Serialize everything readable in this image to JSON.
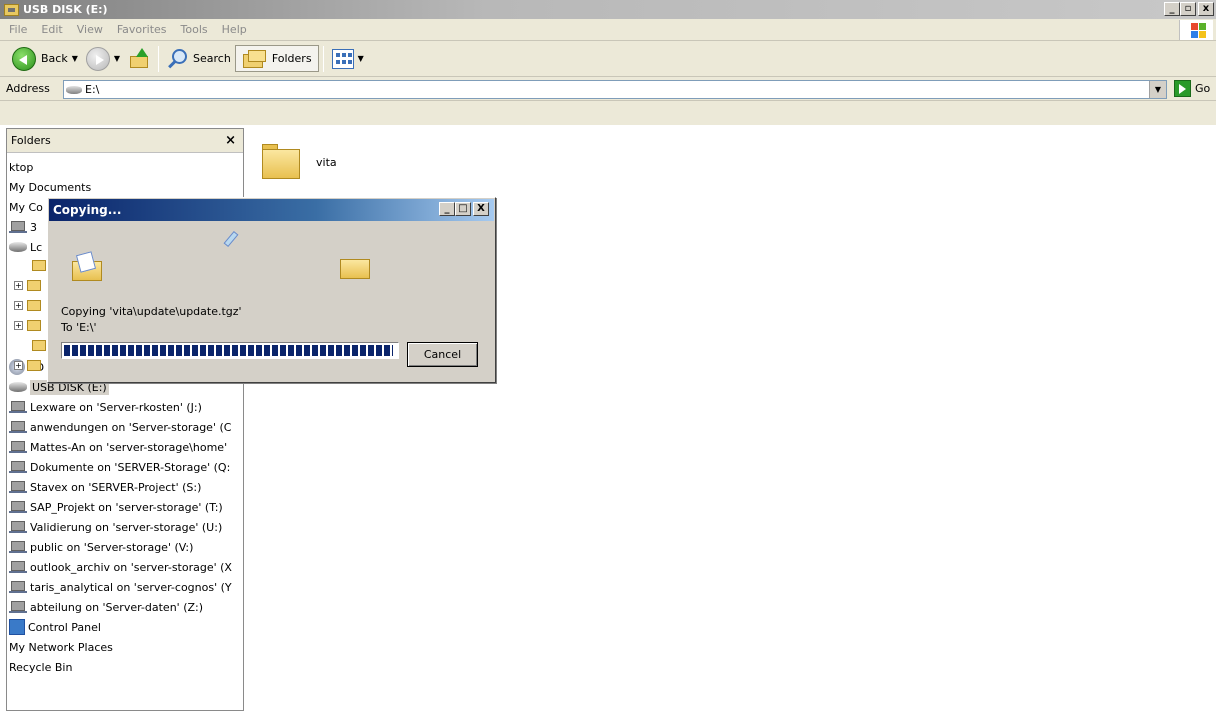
{
  "window": {
    "title": "USB DISK (E:)",
    "controls": {
      "minimize": "_",
      "maximize": "▫",
      "close": "x"
    }
  },
  "menubar": {
    "items": [
      "File",
      "Edit",
      "View",
      "Favorites",
      "Tools",
      "Help"
    ]
  },
  "toolbar": {
    "back_label": "Back",
    "search_label": "Search",
    "folders_label": "Folders"
  },
  "address": {
    "label": "Address",
    "value": "E:\\",
    "go_label": "Go"
  },
  "folders_pane": {
    "title": "Folders",
    "close_glyph": "×",
    "items": [
      {
        "label": "ktop",
        "icon": "none"
      },
      {
        "label": "My Documents",
        "icon": "none"
      },
      {
        "label": "My Co",
        "icon": "none"
      },
      {
        "label": "3",
        "icon": "floppy-icon"
      },
      {
        "label": "Lc",
        "icon": "drive-icon"
      },
      {
        "label": "CD Drive (D:)",
        "icon": "cd-drive-icon"
      },
      {
        "label": "USB DISK (E:)",
        "icon": "drive-icon",
        "selected": true
      },
      {
        "label": "Lexware on 'Server-rkosten' (J:)",
        "icon": "network-drive-icon"
      },
      {
        "label": "anwendungen on 'Server-storage' (C",
        "icon": "network-drive-icon"
      },
      {
        "label": "Mattes-An on 'server-storage\\home'",
        "icon": "network-drive-icon"
      },
      {
        "label": "Dokumente on 'SERVER-Storage' (Q:",
        "icon": "network-drive-icon"
      },
      {
        "label": "Stavex on 'SERVER-Project' (S:)",
        "icon": "network-drive-icon"
      },
      {
        "label": "SAP_Projekt on 'server-storage' (T:)",
        "icon": "network-drive-icon"
      },
      {
        "label": "Validierung on 'server-storage' (U:)",
        "icon": "network-drive-icon"
      },
      {
        "label": "public on 'Server-storage' (V:)",
        "icon": "network-drive-icon"
      },
      {
        "label": "outlook_archiv on 'server-storage' (X",
        "icon": "network-drive-icon"
      },
      {
        "label": "taris_analytical on 'server-cognos' (Y",
        "icon": "network-drive-icon"
      },
      {
        "label": "abteilung on 'Server-daten' (Z:)",
        "icon": "network-drive-icon"
      },
      {
        "label": "Control Panel",
        "icon": "control-panel-icon"
      },
      {
        "label": "My Network Places",
        "icon": "none"
      },
      {
        "label": "Recycle Bin",
        "icon": "none"
      }
    ]
  },
  "main": {
    "folder_name": "vita"
  },
  "copy_dialog": {
    "title": "Copying...",
    "line1": "Copying 'vita\\update\\update.tgz'",
    "line2": "To 'E:\\'",
    "progress": 0.99,
    "cancel_label": "Cancel",
    "controls": {
      "minimize": "_",
      "maximize": "□",
      "close": "X"
    }
  },
  "colors": {
    "dialog_title_start": "#0a246a",
    "progress_fill": "#0a246a",
    "selection": "#d4d0c8"
  }
}
